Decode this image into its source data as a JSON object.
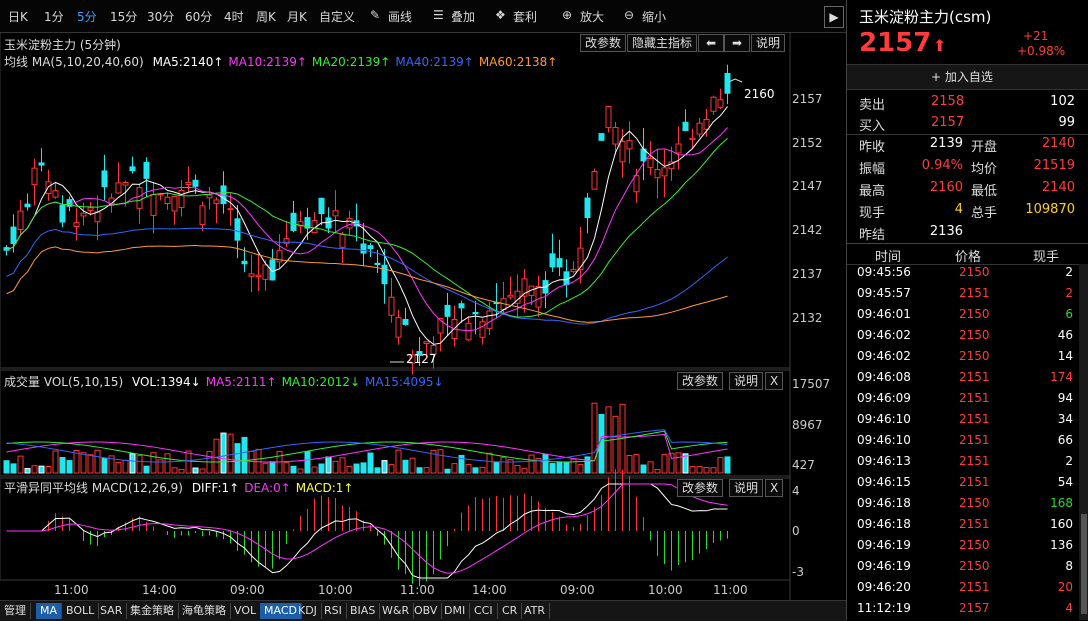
{
  "toolbar": {
    "items": [
      "日K",
      "1分",
      "5分",
      "15分",
      "30分",
      "60分",
      "4时",
      "周K",
      "月K",
      "自定义",
      "画线",
      "叠加",
      "套利",
      "放大",
      "缩小"
    ],
    "active_index": 2
  },
  "main_pane": {
    "title": "玉米淀粉主力 (5分钟)",
    "buttons": [
      "改参数",
      "隐藏主指标",
      "说明"
    ],
    "ma_label": "均线",
    "ma_params": "MA(5,10,20,40,60)",
    "ma_values": [
      {
        "text": "MA5:2140↑",
        "color": "#ffffff"
      },
      {
        "text": "MA10:2139↑",
        "color": "#ff33ff"
      },
      {
        "text": "MA20:2139↑",
        "color": "#33ee33"
      },
      {
        "text": "MA40:2139↑",
        "color": "#3366ff"
      },
      {
        "text": "MA60:2138↑",
        "color": "#ff9933"
      }
    ],
    "axis": [
      "2157",
      "2152",
      "2147",
      "2142",
      "2137",
      "2132"
    ],
    "high_marker": "2160",
    "low_marker": "2127"
  },
  "volume_pane": {
    "label": "成交量",
    "params": "VOL(5,10,15)",
    "values": [
      {
        "text": "VOL:1394↓",
        "color": "#ffffff"
      },
      {
        "text": "MA5:2111↑",
        "color": "#ff33ff"
      },
      {
        "text": "MA10:2012↓",
        "color": "#33ee33"
      },
      {
        "text": "MA15:4095↓",
        "color": "#3366ff"
      }
    ],
    "buttons": [
      "改参数",
      "说明",
      "X"
    ],
    "axis": [
      "17507",
      "8967",
      "427"
    ]
  },
  "macd_pane": {
    "label": "平滑异同平均线",
    "params": "MACD(12,26,9)",
    "values": [
      {
        "text": "DIFF:1↑",
        "color": "#ffffff"
      },
      {
        "text": "DEA:0↑",
        "color": "#ff33ff"
      },
      {
        "text": "MACD:1↑",
        "color": "#ffff33"
      }
    ],
    "buttons": [
      "改参数",
      "说明",
      "X"
    ],
    "axis": [
      "4",
      "0",
      "-3"
    ]
  },
  "time_axis": [
    "11:00",
    "14:00",
    "09:00",
    "10:00",
    "11:00",
    "14:00",
    "09:00",
    "10:00",
    "11:00"
  ],
  "bottom_tabs": [
    "管理",
    "MA",
    "BOLL",
    "SAR",
    "集金策略",
    "海龟策略",
    "VOL",
    "MACD",
    "KDJ",
    "RSI",
    "BIAS",
    "W&R",
    "OBV",
    "DMI",
    "CCI",
    "CR",
    "ATR"
  ],
  "bottom_active": [
    1,
    7
  ],
  "side": {
    "title": "玉米淀粉主力(csm)",
    "price": "2157",
    "change": "+21",
    "change_pct": "+0.98%",
    "add_watch": "+ 加入自选",
    "sell_label": "卖出",
    "sell_price": "2158",
    "sell_qty": "102",
    "buy_label": "买入",
    "buy_price": "2157",
    "buy_qty": "99",
    "stats": [
      {
        "l1": "昨收",
        "v1": "2139",
        "c1": "white",
        "l2": "开盘",
        "v2": "2140",
        "c2": "red"
      },
      {
        "l1": "振幅",
        "v1": "0.94%",
        "c1": "red",
        "l2": "均价",
        "v2": "21519",
        "c2": "red"
      },
      {
        "l1": "最高",
        "v1": "2160",
        "c1": "red",
        "l2": "最低",
        "v2": "2140",
        "c2": "red"
      },
      {
        "l1": "现手",
        "v1": "4",
        "c1": "yellow",
        "l2": "总手",
        "v2": "109870",
        "c2": "yellow"
      },
      {
        "l1": "昨结",
        "v1": "2136",
        "c1": "white",
        "l2": "",
        "v2": "",
        "c2": "white"
      }
    ],
    "trade_headers": [
      "时间",
      "价格",
      "现手"
    ],
    "trades": [
      {
        "t": "09:45:56",
        "p": "2150",
        "q": "2",
        "qc": "white"
      },
      {
        "t": "09:45:57",
        "p": "2151",
        "q": "2",
        "qc": "red"
      },
      {
        "t": "09:46:01",
        "p": "2150",
        "q": "6",
        "qc": "green"
      },
      {
        "t": "09:46:02",
        "p": "2150",
        "q": "46",
        "qc": "white"
      },
      {
        "t": "09:46:02",
        "p": "2150",
        "q": "14",
        "qc": "white"
      },
      {
        "t": "09:46:08",
        "p": "2151",
        "q": "174",
        "qc": "red"
      },
      {
        "t": "09:46:09",
        "p": "2151",
        "q": "94",
        "qc": "white"
      },
      {
        "t": "09:46:10",
        "p": "2151",
        "q": "34",
        "qc": "white"
      },
      {
        "t": "09:46:10",
        "p": "2151",
        "q": "66",
        "qc": "white"
      },
      {
        "t": "09:46:13",
        "p": "2151",
        "q": "2",
        "qc": "white"
      },
      {
        "t": "09:46:15",
        "p": "2151",
        "q": "54",
        "qc": "white"
      },
      {
        "t": "09:46:18",
        "p": "2150",
        "q": "168",
        "qc": "green"
      },
      {
        "t": "09:46:18",
        "p": "2151",
        "q": "160",
        "qc": "white"
      },
      {
        "t": "09:46:19",
        "p": "2150",
        "q": "136",
        "qc": "white"
      },
      {
        "t": "09:46:19",
        "p": "2150",
        "q": "8",
        "qc": "white"
      },
      {
        "t": "09:46:20",
        "p": "2151",
        "q": "20",
        "qc": "red"
      },
      {
        "t": "11:12:19",
        "p": "2157",
        "q": "4",
        "qc": "red"
      }
    ]
  }
}
